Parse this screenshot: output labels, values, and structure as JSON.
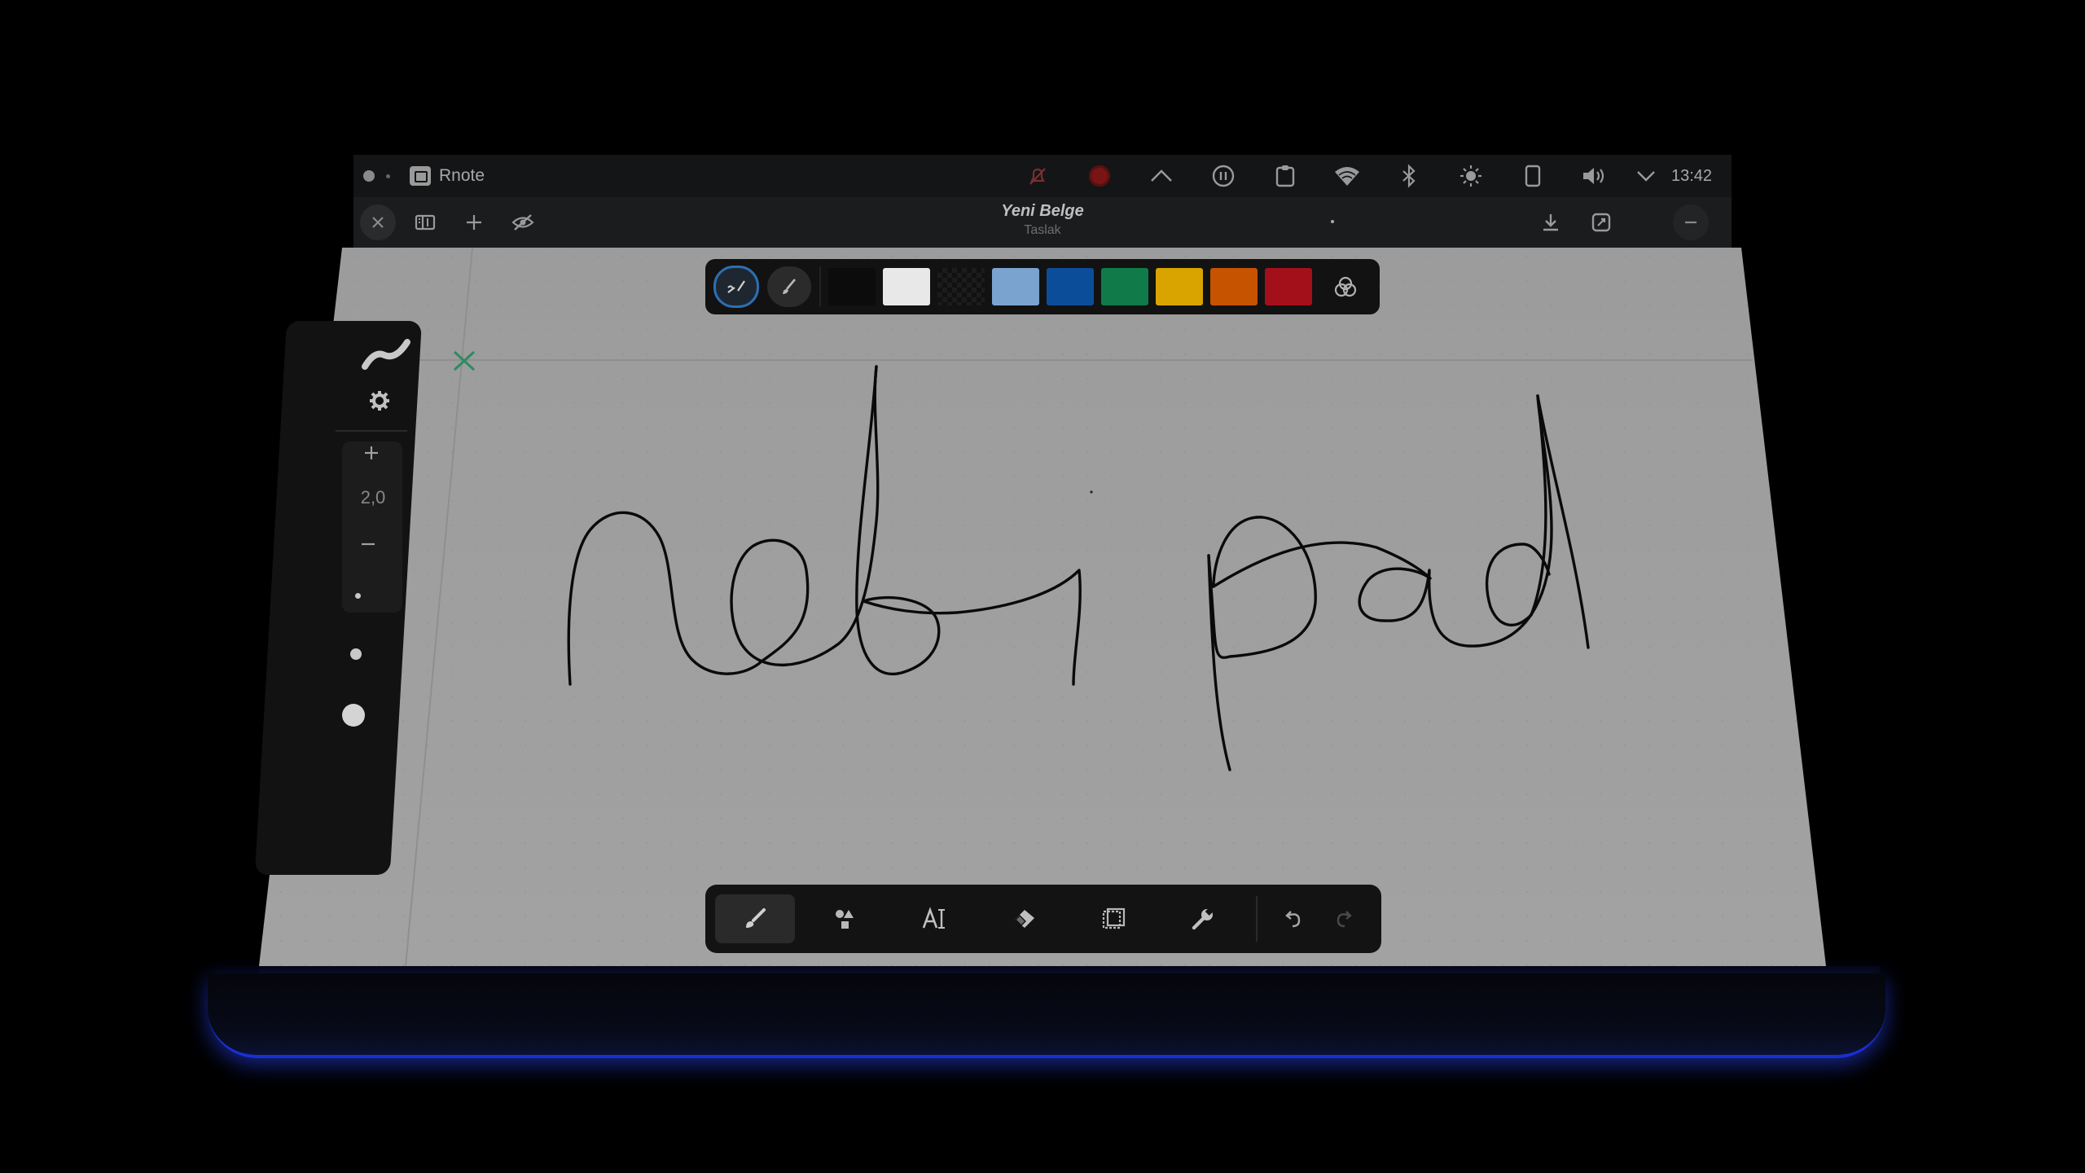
{
  "system": {
    "app_name": "Rnote",
    "clock": "13:42",
    "tray_icons": [
      "notification-off-icon",
      "screen-record-icon",
      "chevron-up-icon",
      "pause-icon",
      "clipboard-icon",
      "wifi-icon",
      "bluetooth-icon",
      "brightness-icon",
      "tablet-icon",
      "volume-icon",
      "chevron-down-icon"
    ]
  },
  "header": {
    "title": "Yeni Belge",
    "subtitle": "Taslak",
    "left_icons": [
      "close-icon",
      "sidebar-toggle-icon",
      "new-tab-icon",
      "hide-eye-icon"
    ],
    "right_icons": [
      "download-icon",
      "save-as-icon",
      "minimize-icon"
    ]
  },
  "palette": {
    "modes": [
      "pen-style-icon",
      "brush-style-icon"
    ],
    "colors": [
      "#0c0c0c",
      "#e8e8e8",
      "#161616",
      "#7aa4cf",
      "#0c4d9a",
      "#107a48",
      "#d9a400",
      "#c55300",
      "#a3101a"
    ],
    "picker_icon": "color-picker-icon",
    "colors_note": "swatch colors"
  },
  "sidebar": {
    "stroke_icon": "brush-stroke-icon",
    "settings_icon": "gear-icon",
    "width_value": "2,0",
    "sizes": [
      "small-dot",
      "medium-dot",
      "large-dot"
    ]
  },
  "toolbar": {
    "tools": [
      "brush-icon",
      "shapes-icon",
      "text-icon",
      "eraser-icon",
      "selector-icon",
      "tools-wrench-icon"
    ],
    "undo_icon": "undo-icon",
    "redo_icon": "redo-icon"
  },
  "colors": {
    "canvas_bg": "#9a9a9a",
    "accent": "#2c6fb4",
    "glow": "#1a2fd0"
  }
}
